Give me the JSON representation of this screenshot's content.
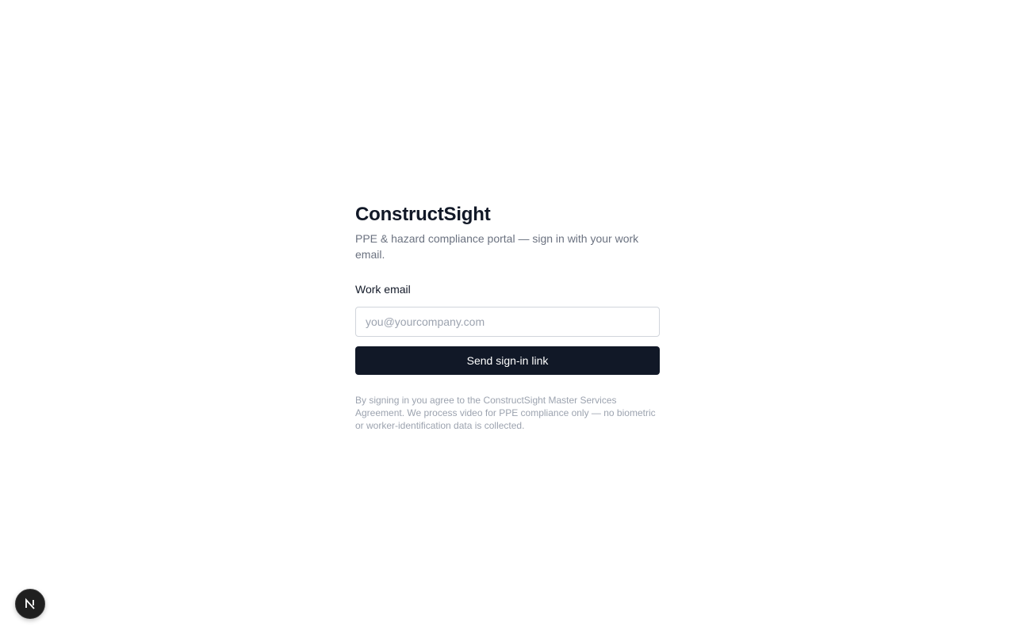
{
  "app": {
    "title": "ConstructSight",
    "subtitle": "PPE & hazard compliance portal — sign in with your work email."
  },
  "form": {
    "email_label": "Work email",
    "email_value": "",
    "email_placeholder": "you@yourcompany.com",
    "submit_label": "Send sign-in link"
  },
  "legal": {
    "text": "By signing in you agree to the ConstructSight Master Services Agreement. We process video for PPE compliance only — no biometric or worker-identification data is collected."
  },
  "dev_badge": {
    "icon": "nextjs-n-icon"
  },
  "colors": {
    "primary": "#111827",
    "muted_text": "#6b7280",
    "subtle_text": "#9ca3af",
    "border": "#d1d5db"
  }
}
